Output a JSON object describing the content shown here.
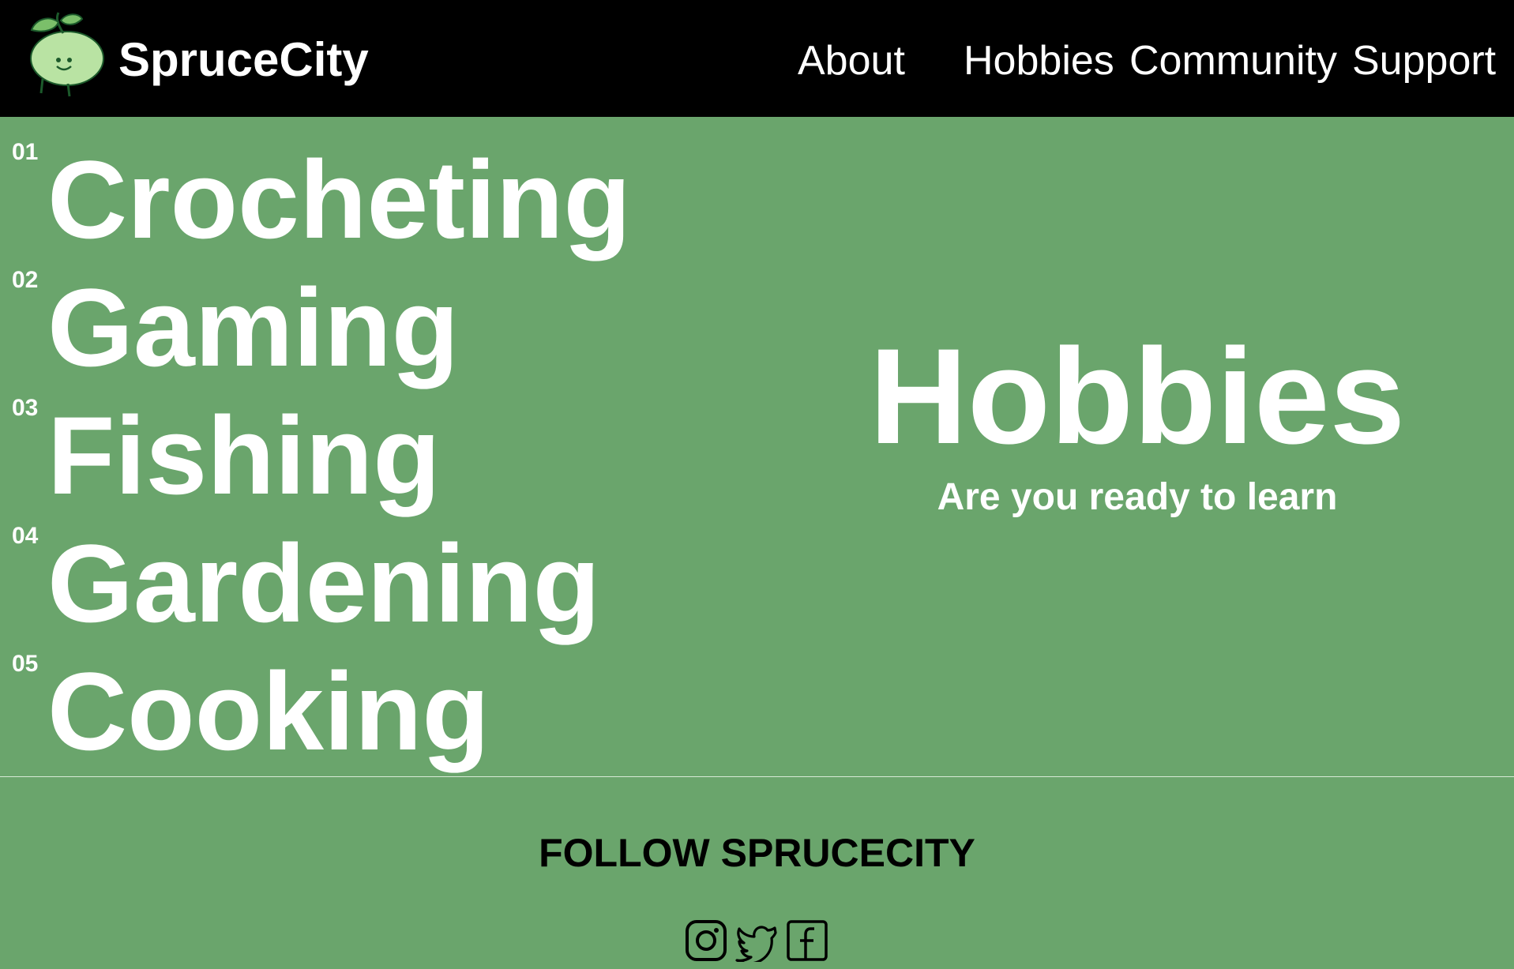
{
  "header": {
    "brand": "SpruceCity",
    "nav": {
      "about": "About",
      "hobbies": "Hobbies",
      "community": "Community",
      "support": "Support"
    }
  },
  "hobbies": [
    {
      "number": "01",
      "name": "Crocheting"
    },
    {
      "number": "02",
      "name": "Gaming"
    },
    {
      "number": "03",
      "name": "Fishing"
    },
    {
      "number": "04",
      "name": "Gardening"
    },
    {
      "number": "05",
      "name": "Cooking"
    }
  ],
  "hero": {
    "title": "Hobbies",
    "subtitle": "Are you ready to learn"
  },
  "footer": {
    "follow_title": "FOLLOW SPRUCECITY",
    "social_icons": [
      "instagram-icon",
      "twitter-icon",
      "facebook-icon"
    ]
  },
  "colors": {
    "header_background": "#000000",
    "page_background": "#6aa56c",
    "text": "#ffffff",
    "logo_green": "#b9e3a3"
  }
}
